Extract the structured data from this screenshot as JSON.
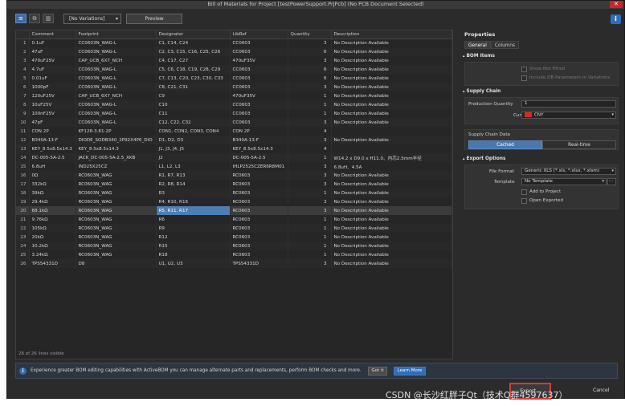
{
  "window": {
    "title": "Bill of Materials for Project [testPowerSupport.PrjPcb] (No PCB Document Selected)",
    "close_glyph": "✕"
  },
  "toolbar": {
    "variation_value": "[No Variations]",
    "preview_label": "Preview"
  },
  "grid": {
    "columns": [
      "",
      "Comment",
      "Footprint",
      "Designator",
      "LibRef",
      "Quantity",
      "Description"
    ],
    "rows": [
      [
        "1",
        "0.1uF",
        "CC0603N_WAG-L",
        "C1, C14, C24",
        "CC0603",
        "3",
        "No Description Available"
      ],
      [
        "2",
        "47uF",
        "CC0603N_WAG-L",
        "C2, C3, C15, C16, C25, C26",
        "CC0603",
        "6",
        "No Description Available"
      ],
      [
        "3",
        "470uF25V",
        "CAP_UCB_6X7_NCH",
        "C4, C17, C27",
        "470uF35V",
        "3",
        "No Description Available"
      ],
      [
        "4",
        "4.7uF",
        "CC0603N_WAG-L",
        "C5, C6, C18, C19, C28, C29",
        "CC0603",
        "6",
        "No Description Available"
      ],
      [
        "5",
        "0.01uF",
        "CC0603N_WAG-L",
        "C7, C13, C20, C23, C30, C33",
        "CC0603",
        "6",
        "No Description Available"
      ],
      [
        "6",
        "1000pF",
        "CC0603N_WAG-L",
        "C8, C21, C31",
        "CC0603",
        "3",
        "No Description Available"
      ],
      [
        "7",
        "120uF25V",
        "CAP_UCB_6X7_NCH",
        "C9",
        "470uF35V",
        "1",
        "No Description Available"
      ],
      [
        "8",
        "10uF25V",
        "CC0603N_WAG-L",
        "C10",
        "CC0603",
        "1",
        "No Description Available"
      ],
      [
        "9",
        "100nF25V",
        "CC0603N_WAG-L",
        "C11",
        "CC0603",
        "1",
        "No Description Available"
      ],
      [
        "10",
        "47pF",
        "CC0603N_WAG-L",
        "C12, C22, C32",
        "CC0603",
        "3",
        "No Description Available"
      ],
      [
        "11",
        "CON 2P",
        "KF128-3.81-2P",
        "CON1, CON2, CON3, CON4",
        "CON 2P",
        "4",
        ""
      ],
      [
        "12",
        "B340A-13-F",
        "DIODE_SODB340_2P92X4P6_DIO",
        "D1, D2, D3",
        "B340A-13-F",
        "3",
        "No Description Available"
      ],
      [
        "13",
        "KEY_8.5x8.5x14.3",
        "KEY_8.5x8.5x14.3",
        "J1, J3, J4, J5",
        "KEY_8.5x8.5x14.3",
        "4",
        ""
      ],
      [
        "14",
        "DC-005-5A-2.5",
        "JACK_DC-005-5A-2.5_XKB",
        "J2",
        "DC-005-5A-2.5",
        "1",
        "W14.2 x D9.0 x H11.0、内芯2.5mm半径"
      ],
      [
        "15",
        "6.8uH",
        "IND25X25CZ",
        "L1, L2, L3",
        "IHLP2525CZER6R8M01",
        "3",
        "6.8uH、4.5A"
      ],
      [
        "16",
        "0Ω",
        "RC0603N_WAG",
        "R1, R7, R13",
        "RC0603",
        "3",
        "No Description Available"
      ],
      [
        "17",
        "332kΩ",
        "RC0603N_WAG",
        "R2, R8, R14",
        "RC0603",
        "3",
        "No Description Available"
      ],
      [
        "18",
        "39kΩ",
        "RC0603N_WAG",
        "R3",
        "RC0603",
        "1",
        "No Description Available"
      ],
      [
        "19",
        "29.4kΩ",
        "RC0603N_WAG",
        "R4, R10, R16",
        "RC0603",
        "3",
        "No Description Available"
      ],
      [
        "20",
        "68.1kΩ",
        "RC0603N_WAG",
        "R5, R11, R17",
        "RC0603",
        "3",
        "No Description Available"
      ],
      [
        "21",
        "9.76kΩ",
        "RC0603N_WAG",
        "R6",
        "RC0603",
        "1",
        "No Description Available"
      ],
      [
        "22",
        "105kΩ",
        "RC0603N_WAG",
        "R9",
        "RC0603",
        "1",
        "No Description Available"
      ],
      [
        "23",
        "20kΩ",
        "RC0603N_WAG",
        "R12",
        "RC0603",
        "1",
        "No Description Available"
      ],
      [
        "24",
        "10.2kΩ",
        "RC0603N_WAG",
        "R15",
        "RC0603",
        "1",
        "No Description Available"
      ],
      [
        "25",
        "3.24kΩ",
        "RC0603N_WAG",
        "R18",
        "RC0603",
        "1",
        "No Description Available"
      ],
      [
        "26",
        "TPS54331D",
        "D8",
        "U1, U2, U3",
        "TPS54331D",
        "3",
        "No Description Available"
      ]
    ],
    "selected_row": 20,
    "lines_visible": "26 of 26 lines visible"
  },
  "infobar": {
    "message": "Experience greater BOM editing capabilities with ActiveBOM you can manage alternate parts and replacements, perform BOM checks and more.",
    "got_it": "Got it",
    "learn_more": "Learn More"
  },
  "props": {
    "title": "Properties",
    "tabs": [
      "General",
      "Columns"
    ],
    "bom_items": {
      "header": "BOM Items",
      "show_not_fitted": "Show Not Fitted",
      "include_db": "Include DB Parameters in Variations"
    },
    "supply_chain": {
      "header": "Supply Chain",
      "production_quantity_label": "Production Quantity",
      "production_quantity_value": "1",
      "currency_label": "Currency",
      "currency_value": "CNY",
      "data_header": "Supply Chain Data",
      "cached": "Cached",
      "realtime": "Real-time"
    },
    "export": {
      "header": "Export Options",
      "file_format_label": "File Format",
      "file_format_value": "Generic XLS (*.xls, *.xlsx, *.xlsm)",
      "template_label": "Template",
      "template_value": "No Template",
      "add_to_project": "Add to Project",
      "open_exported": "Open Exported"
    }
  },
  "footer": {
    "export_label": "Export...",
    "cancel_label": "Cancel"
  },
  "watermark": "CSDN @长沙红胖子Qt（技术Q群4597637）"
}
